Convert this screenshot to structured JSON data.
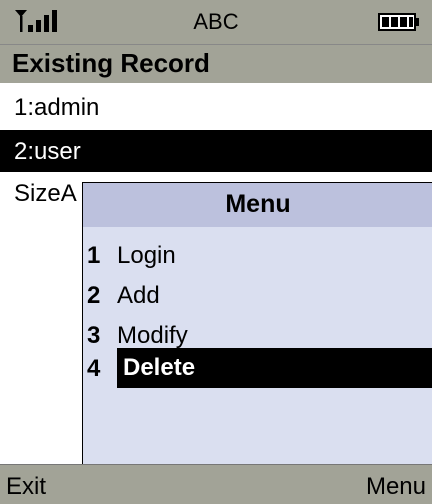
{
  "status": {
    "input_mode": "ABC",
    "signal_icon": "signal-icon",
    "battery_icon": "battery-icon"
  },
  "screen": {
    "title": "Existing Record"
  },
  "records": [
    {
      "label": "1:admin"
    },
    {
      "label": "2:user"
    },
    {
      "label": "SizeA"
    }
  ],
  "menu": {
    "title": "Menu",
    "items": [
      {
        "number": "1",
        "label": "Login"
      },
      {
        "number": "2",
        "label": "Add"
      },
      {
        "number": "3",
        "label": "Modify"
      },
      {
        "number": "4",
        "label": "Delete"
      }
    ]
  },
  "softkeys": {
    "left": "Exit",
    "right": "Menu"
  },
  "colors": {
    "chrome": "#a2a397",
    "menu_bg": "#dadff0",
    "menu_title_bg": "#bcc1dd",
    "selection": "#000000"
  }
}
